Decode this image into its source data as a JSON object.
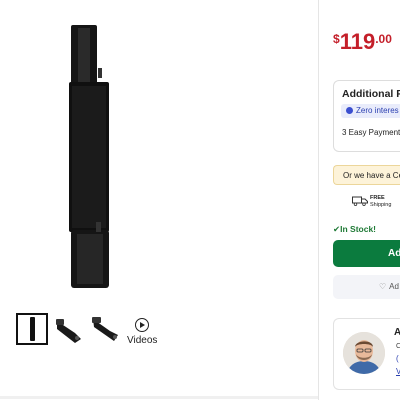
{
  "price": {
    "currency": "$",
    "dollars": "119",
    "cents": ".00"
  },
  "payment": {
    "title": "Additional Pa",
    "badge": "Zero interes",
    "easy": "3 Easy Payment"
  },
  "cert_banner": "Or we have a Cer",
  "shipping": {
    "line1": "FREE",
    "line2": "Shipping"
  },
  "stock": "In Stock!",
  "add_button": "Ad",
  "wish_button": "Ad",
  "media": {
    "videos_label": "Videos"
  },
  "advisor": {
    "name": "A",
    "line1": "C",
    "line2": "(",
    "line3": "V"
  },
  "colors": {
    "price": "#c41f2a",
    "add_button": "#0b7b3e",
    "stock": "#1f7a36",
    "cert_bg": "#fdf3d9"
  },
  "icons": [
    "check-icon",
    "truck-icon",
    "heart-icon",
    "play-icon",
    "zero-interest-icon"
  ]
}
